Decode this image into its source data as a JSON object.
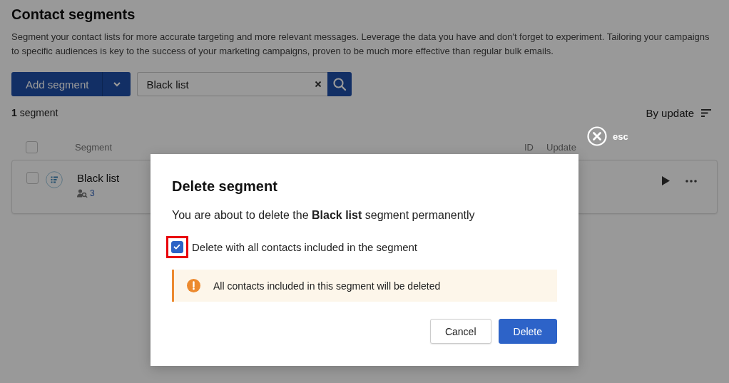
{
  "page": {
    "title": "Contact segments",
    "description": "Segment your contact lists for more accurate targeting and more relevant messages. Leverage the data you have and don't forget to experiment. Tailoring your campaigns to specific audiences is key to the success of your marketing campaigns, proven to be much more effective than regular bulk emails.",
    "add_button": "Add segment",
    "search": {
      "value": "Black list"
    },
    "count": "**1** segment",
    "sort": "By update",
    "header_checked": false,
    "columns": [
      {
        "label": "Segment"
      },
      {
        "label": "ID"
      },
      {
        "label": "Update"
      }
    ],
    "rows": [
      {
        "name": "Black list",
        "contacts": "3",
        "checked": false
      }
    ]
  },
  "close": {
    "label": "esc"
  },
  "dialog": {
    "title": "Delete segment",
    "message": "You are about to delete the **Black list** segment permanently",
    "option": {
      "label": "Delete with all contacts included in the segment",
      "checked": true,
      "highlighted": true
    },
    "warning": "All contacts included in this segment will be deleted",
    "buttons": [
      {
        "label": "Cancel",
        "kind": "secondary"
      },
      {
        "label": "Delete",
        "kind": "primary"
      }
    ]
  }
}
